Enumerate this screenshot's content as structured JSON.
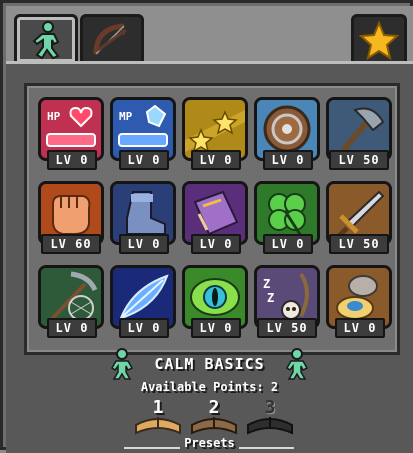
{
  "tabs": [
    {
      "name": "tab-skills",
      "icon": "figure-icon",
      "active": true
    },
    {
      "name": "tab-bow",
      "icon": "bow-icon",
      "active": false
    },
    {
      "name": "tab-favorites",
      "icon": "star-icon",
      "active": false
    }
  ],
  "skills": [
    {
      "icon": "hp-heart-icon",
      "level": "LV 0"
    },
    {
      "icon": "mp-crystal-icon",
      "level": "LV 0"
    },
    {
      "icon": "stars-icon",
      "level": "LV 0"
    },
    {
      "icon": "shield-icon",
      "level": "LV 0"
    },
    {
      "icon": "axe-icon",
      "level": "LV 50"
    },
    {
      "icon": "fist-icon",
      "level": "LV 60"
    },
    {
      "icon": "boot-icon",
      "level": "LV 0"
    },
    {
      "icon": "spellbook-icon",
      "level": "LV 0"
    },
    {
      "icon": "clover-icon",
      "level": "LV 0"
    },
    {
      "icon": "sword-icon",
      "level": "LV 50"
    },
    {
      "icon": "pickaxe-net-icon",
      "level": "LV 0"
    },
    {
      "icon": "feather-icon",
      "level": "LV 0"
    },
    {
      "icon": "eye-icon",
      "level": "LV 0"
    },
    {
      "icon": "sleep-skull-icon",
      "level": "LV 50"
    },
    {
      "icon": "rock-egg-icon",
      "level": "LV 0"
    }
  ],
  "title": "CALM BASICS",
  "points": {
    "label": "Available Points:",
    "value": "2"
  },
  "presets": {
    "label": "Presets",
    "items": [
      {
        "number": "1",
        "active": true
      },
      {
        "number": "2",
        "active": true
      },
      {
        "number": "3",
        "active": false
      }
    ]
  },
  "colors": {
    "panel": "#585858",
    "grid": "#6f6f6f",
    "hp": "#e0304a",
    "mp": "#3c7ad8",
    "accent": "#f5b820"
  }
}
